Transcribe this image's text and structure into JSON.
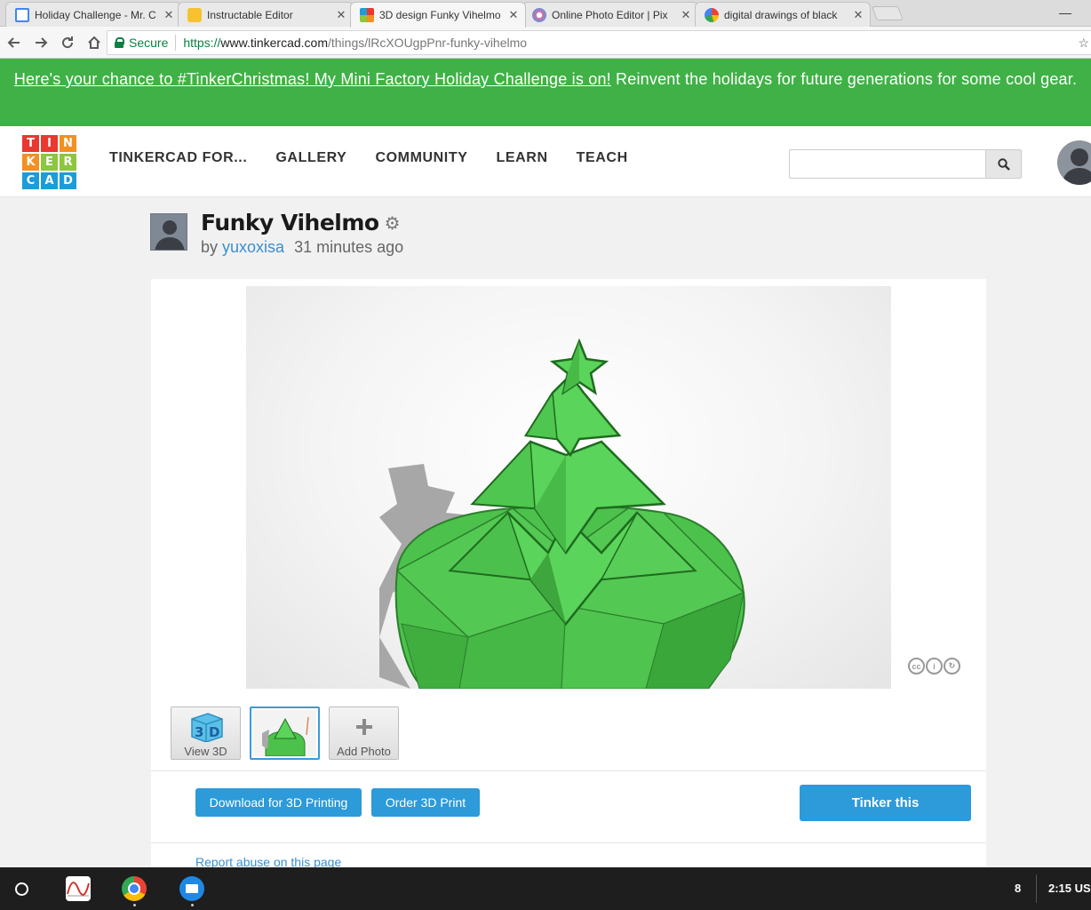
{
  "browser": {
    "tabs": [
      {
        "title": "Holiday Challenge - Mr. C",
        "favicon": "docs-icon",
        "active": false
      },
      {
        "title": "Instructable Editor",
        "favicon": "instructables-robot-icon",
        "active": false
      },
      {
        "title": "3D design Funky Vihelmo",
        "favicon": "tinkercad-icon",
        "active": true
      },
      {
        "title": "Online Photo Editor | Pix",
        "favicon": "pixlr-icon",
        "active": false
      },
      {
        "title": "digital drawings of black",
        "favicon": "google-icon",
        "active": false
      }
    ],
    "close_glyph": "✕",
    "secure_label": "Secure",
    "url_scheme": "https://",
    "url_host": "www.tinkercad.com",
    "url_path": "/things/lRcXOUgpPnr-funky-vihelmo"
  },
  "banner": {
    "link_text": "Here's your chance to #TinkerChristmas! My Mini Factory Holiday Challenge is on!",
    "text": " Reinvent the holidays for future generations for some cool gear."
  },
  "header": {
    "logo_letters": [
      "T",
      "I",
      "N",
      "K",
      "E",
      "R",
      "C",
      "A",
      "D"
    ],
    "logo_colors": [
      "#e8382f",
      "#e8382f",
      "#f29022",
      "#f29022",
      "#8dc63f",
      "#8dc63f",
      "#1c9cd8",
      "#1c9cd8",
      "#1c9cd8"
    ],
    "nav": [
      "TINKERCAD FOR...",
      "GALLERY",
      "COMMUNITY",
      "LEARN",
      "TEACH"
    ],
    "search_placeholder": ""
  },
  "thing": {
    "title": "Funky Vihelmo",
    "by": "by",
    "author": "yuxoxisa",
    "time": "31 minutes ago",
    "thumbs": [
      {
        "label": "View 3D"
      },
      {
        "label": ""
      },
      {
        "label": "Add Photo"
      }
    ],
    "download_label": "Download for 3D Printing",
    "order_label": "Order 3D Print",
    "tinker_label": "Tinker this",
    "report_label": "Report abuse on this page"
  },
  "shelf": {
    "notification_count": "8",
    "time": "2:15 US"
  },
  "colors": {
    "banner": "#40b147",
    "accent_blue": "#2d9ad9",
    "model_green": "#4fc14f"
  }
}
